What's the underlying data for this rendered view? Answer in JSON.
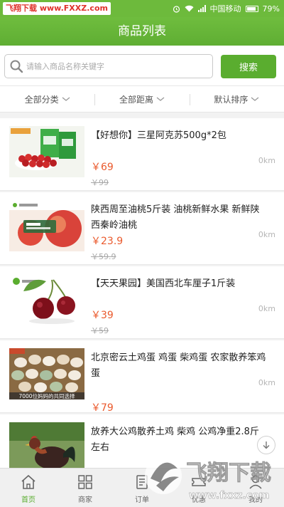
{
  "status_bar": {
    "watermark": "飞翔下载 www.FXXZ.com",
    "carrier": "中国移动",
    "battery": "79%"
  },
  "header": {
    "title": "商品列表"
  },
  "search": {
    "placeholder": "请输入商品名称关键字",
    "button_label": "搜索"
  },
  "filters": [
    {
      "label": "全部分类"
    },
    {
      "label": "全部距离"
    },
    {
      "label": "默认排序"
    }
  ],
  "products": [
    {
      "name": "【好想你】三星阿克苏500g*2包",
      "price": "￥69",
      "original_price": "￥99",
      "distance": "0km",
      "image": "red-dates-bags"
    },
    {
      "name": "陕西周至油桃5斤装 油桃新鲜水果 新鲜陕西秦岭油桃",
      "price": "￥23.9",
      "original_price": "￥59.9",
      "distance": "0km",
      "image": "nectarines"
    },
    {
      "name": "【天天果园】美国西北车厘子1斤装",
      "price": "￥39",
      "original_price": "￥59",
      "distance": "0km",
      "image": "cherries"
    },
    {
      "name": "北京密云土鸡蛋 鸡蛋 柴鸡蛋 农家散养笨鸡蛋",
      "price": "￥79",
      "original_price": "",
      "distance": "0km",
      "image": "eggs-basket",
      "image_caption": "7000位妈妈的共同选择"
    },
    {
      "name": "放养大公鸡散养土鸡 柴鸡 公鸡净重2.8斤左右",
      "price": "",
      "original_price": "",
      "distance": "",
      "image": "rooster"
    }
  ],
  "tabbar": [
    {
      "label": "首页",
      "icon": "home-icon",
      "active": true
    },
    {
      "label": "商家",
      "icon": "grid-icon",
      "active": false
    },
    {
      "label": "订单",
      "icon": "order-icon",
      "active": false
    },
    {
      "label": "优惠",
      "icon": "coupon-icon",
      "active": false
    },
    {
      "label": "我的",
      "icon": "user-icon",
      "active": false
    }
  ],
  "watermark_logo": {
    "text": "飞翔下载",
    "url": "www.fxxz.com"
  },
  "colors": {
    "brand_green": "#5aad2f",
    "price_orange": "#ea5a2d",
    "watermark_red": "#e0322b"
  }
}
